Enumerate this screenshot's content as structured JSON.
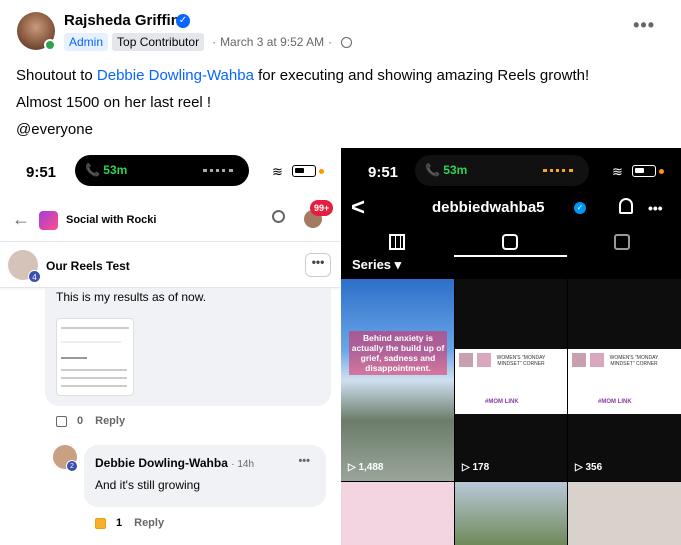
{
  "post": {
    "author": "Rajsheda Griffin",
    "badge_admin": "Admin",
    "badge_top": "Top Contributor",
    "timestamp": "March 3 at 9:52 AM",
    "more_label": "•••",
    "line1_prefix": "Shoutout to ",
    "line1_mention": "Debbie Dowling-Wahba",
    "line1_suffix": " for executing and showing amazing Reels growth!",
    "line2": "Almost 1500 on her last reel !",
    "line3": "@everyone"
  },
  "left_screenshot": {
    "time": "9:51",
    "call_time": "53m",
    "group_name": "Social with Rocki",
    "notif_count": "99+",
    "thread_title": "Our Reels Test",
    "thread_badge": "4",
    "thread_more": "•••",
    "comment_text": "This is my results as of now.",
    "comment_likes": "0",
    "comment_reply": "Reply",
    "reply_author": "Debbie Dowling-Wahba",
    "reply_time": "· 14h",
    "reply_badge": "2",
    "reply_text": "And it's still growing",
    "reply_more": "•••",
    "reply_likes": "1",
    "reply_reply": "Reply"
  },
  "right_screenshot": {
    "time": "9:51",
    "call_time": "53m",
    "back": "<",
    "username": "debbiedwahba5",
    "more": "•••",
    "series_label": "Series ▾",
    "reel1_caption": "Behind anxiety is actually the build up of grief, sadness and disappointment.",
    "reel1_views": "▷ 1,488",
    "reel2_views": "▷ 178",
    "reel3_views": "▷ 356",
    "flyer_title": "WOMEN'S \"MONDAY MINDSET\" CORNER",
    "flyer_logo": "#MOM LINK"
  },
  "colors": {
    "accent": "#0866ff",
    "online": "#31a24c",
    "notif": "#e41e3f"
  }
}
